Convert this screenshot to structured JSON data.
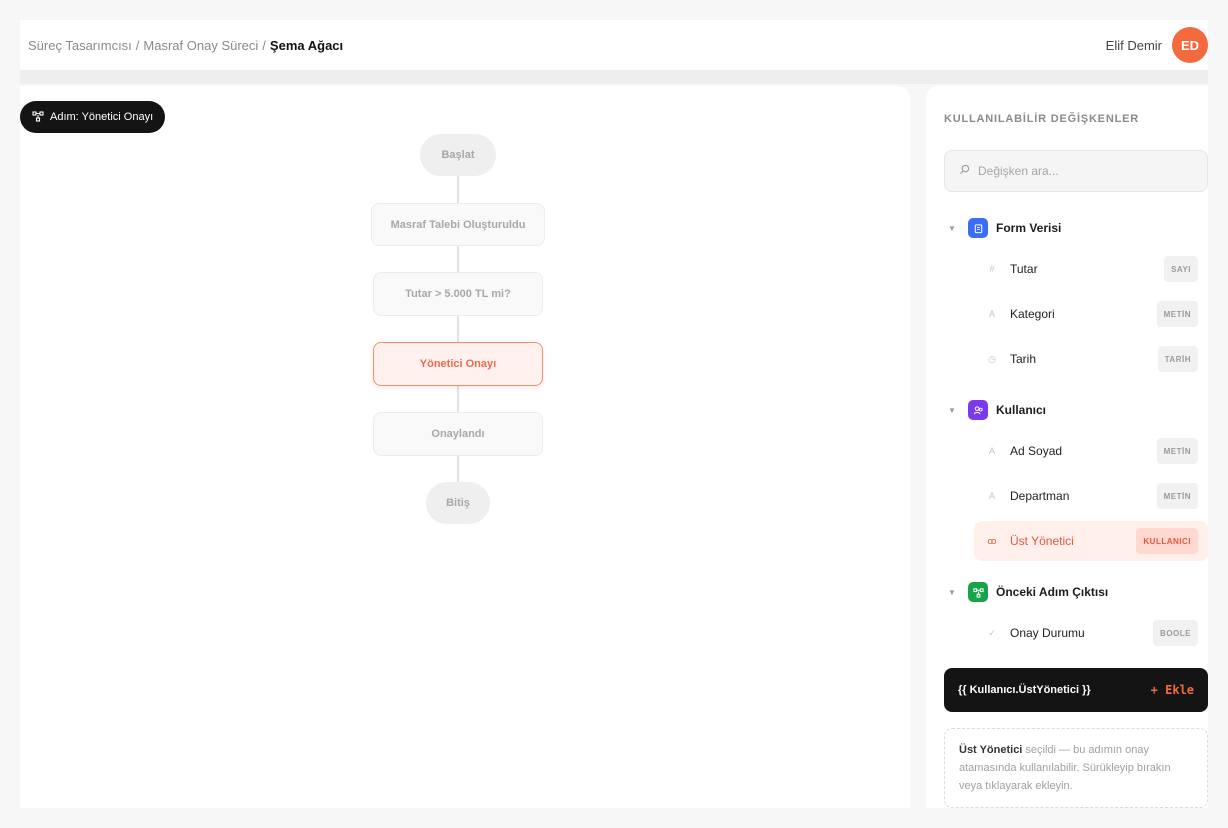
{
  "breadcrumb": {
    "items": [
      "Süreç Tasarımcısı",
      "Masraf Onay Süreci"
    ],
    "separator": "/",
    "current": "Şema Ağacı"
  },
  "user": {
    "name": "Elif Demir",
    "initials": "ED",
    "avatar_color": "#f26a3d"
  },
  "canvas": {
    "step_badge": "Adım: Yönetici Onayı",
    "nodes": [
      {
        "label": "Başlat",
        "kind": "start"
      },
      {
        "label": "Masraf Talebi Oluşturuldu",
        "kind": "task"
      },
      {
        "label": "Tutar > 5.000 TL mi?",
        "kind": "decision"
      },
      {
        "label": "Yönetici Onayı",
        "kind": "task",
        "active": true
      },
      {
        "label": "Onaylandı",
        "kind": "task"
      },
      {
        "label": "Bitiş",
        "kind": "end"
      }
    ]
  },
  "panel": {
    "title": "KULLANILABİLİR DEĞİŞKENLER",
    "search_placeholder": "Değişken ara...",
    "groups": [
      {
        "label": "Form Verisi",
        "icon": "clipboard-icon",
        "color": "#3b6ef5",
        "vars": [
          {
            "name": "Tutar",
            "type": "SAYI",
            "icon": "hash-icon"
          },
          {
            "name": "Kategori",
            "type": "METİN",
            "icon": "text-icon"
          },
          {
            "name": "Tarih",
            "type": "TARİH",
            "icon": "clock-icon"
          }
        ]
      },
      {
        "label": "Kullanıcı",
        "icon": "users-icon",
        "color": "#7c3aed",
        "vars": [
          {
            "name": "Ad Soyad",
            "type": "METİN",
            "icon": "text-icon"
          },
          {
            "name": "Departman",
            "type": "METİN",
            "icon": "text-icon"
          },
          {
            "name": "Üst Yönetici",
            "type": "KULLANICI",
            "icon": "users-icon",
            "selected": true
          }
        ]
      },
      {
        "label": "Önceki Adım Çıktısı",
        "icon": "flow-icon",
        "color": "#16a34a",
        "vars": [
          {
            "name": "Onay Durumu",
            "type": "BOOLE",
            "icon": "check-icon"
          }
        ]
      }
    ],
    "expression": "{{ Kullanıcı.ÜstYönetici }}",
    "add_label": "+ Ekle",
    "hint_strong": "Üst Yönetici",
    "hint_text": " seçildi — bu adımın onay atamasında kullanılabilir. Sürükleyip bırakın veya tıklayarak ekleyin."
  },
  "colors": {
    "accent": "#f26a3d",
    "active_node": "#ec6a52"
  }
}
